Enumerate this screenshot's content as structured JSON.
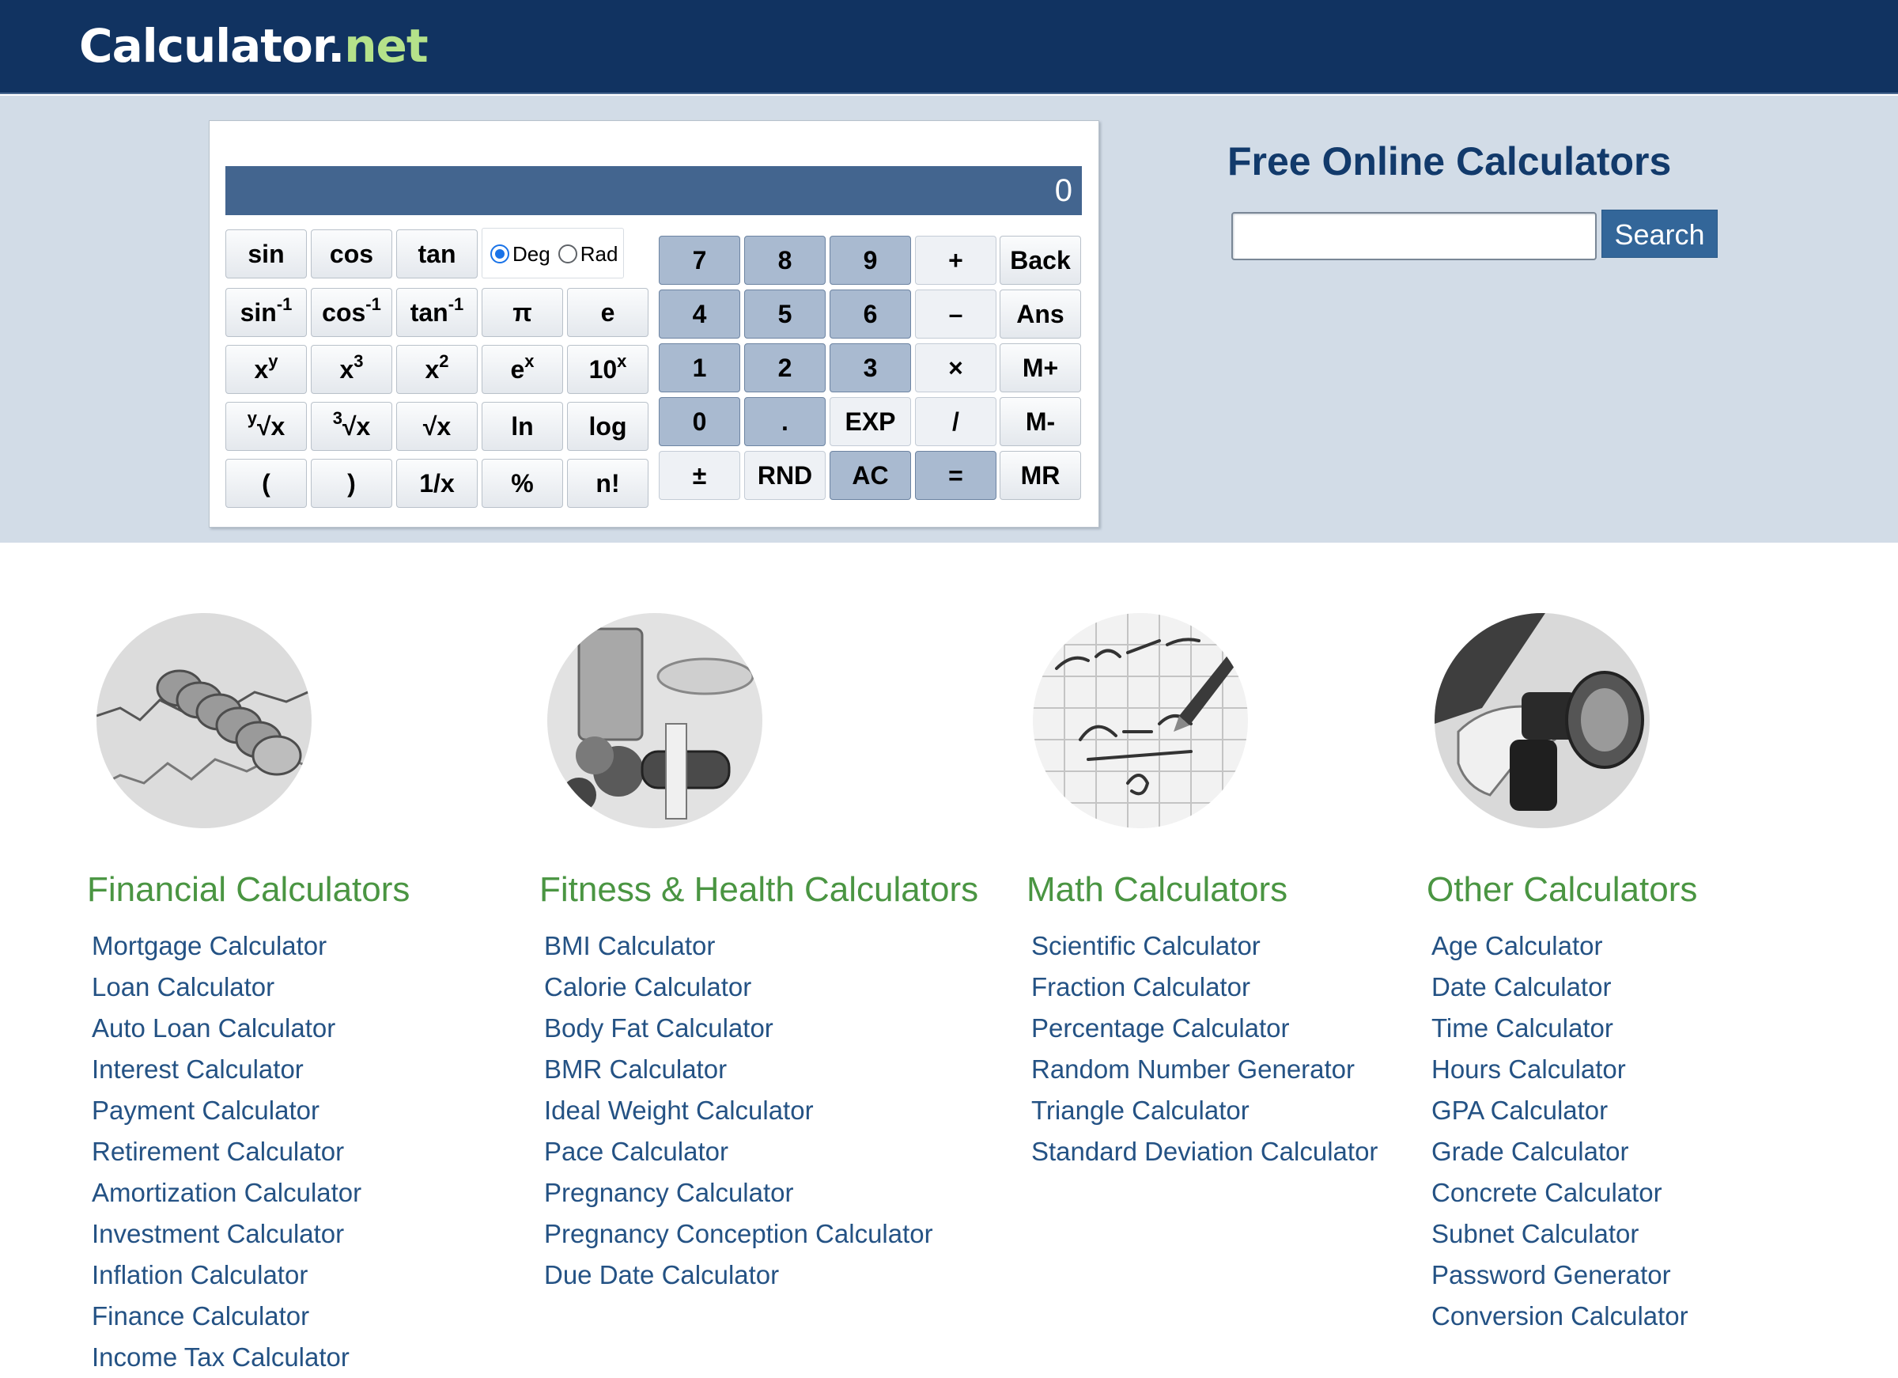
{
  "header": {
    "logo_main": "Calculator",
    "logo_dot": ".",
    "logo_tld": "net"
  },
  "calculator": {
    "display": "0",
    "sci_keys": {
      "sin": "sin",
      "cos": "cos",
      "tan": "tan",
      "asin": "sin",
      "acos": "cos",
      "atan": "tan",
      "inv_sup": "-1",
      "pi": "π",
      "e": "e",
      "x": "x",
      "y_sup": "y",
      "three": "3",
      "two": "2",
      "e_base": "e",
      "ten": "10",
      "y_root": "y",
      "root_x": "√x",
      "cbrt": "3",
      "sqrt": "√x",
      "ln": "ln",
      "log": "log",
      "lparen": "(",
      "rparen": ")",
      "reciprocal": "1/x",
      "percent": "%",
      "factorial": "n!"
    },
    "angle": {
      "deg": "Deg",
      "rad": "Rad",
      "selected": "Deg"
    },
    "num_keys": {
      "k7": "7",
      "k8": "8",
      "k9": "9",
      "plus": "+",
      "back": "Back",
      "k4": "4",
      "k5": "5",
      "k6": "6",
      "minus": "–",
      "ans": "Ans",
      "k1": "1",
      "k2": "2",
      "k3": "3",
      "times": "×",
      "mplus": "M+",
      "k0": "0",
      "dot": ".",
      "exp": "EXP",
      "divide": "/",
      "mminus": "M-",
      "plusminus": "±",
      "rnd": "RND",
      "ac": "AC",
      "equals": "=",
      "mr": "MR"
    }
  },
  "search": {
    "title": "Free Online Calculators",
    "placeholder": "",
    "button": "Search"
  },
  "categories": [
    {
      "title": "Financial Calculators",
      "image_icon": "coins-chart-photo",
      "links": [
        "Mortgage Calculator",
        "Loan Calculator",
        "Auto Loan Calculator",
        "Interest Calculator",
        "Payment Calculator",
        "Retirement Calculator",
        "Amortization Calculator",
        "Investment Calculator",
        "Inflation Calculator",
        "Finance Calculator",
        "Income Tax Calculator"
      ]
    },
    {
      "title": "Fitness & Health Calculators",
      "image_icon": "fitness-food-photo",
      "links": [
        "BMI Calculator",
        "Calorie Calculator",
        "Body Fat Calculator",
        "BMR Calculator",
        "Ideal Weight Calculator",
        "Pace Calculator",
        "Pregnancy Calculator",
        "Pregnancy Conception Calculator",
        "Due Date Calculator"
      ]
    },
    {
      "title": "Math Calculators",
      "image_icon": "math-formula-photo",
      "links": [
        "Scientific Calculator",
        "Fraction Calculator",
        "Percentage Calculator",
        "Random Number Generator",
        "Triangle Calculator",
        "Standard Deviation Calculator"
      ]
    },
    {
      "title": "Other Calculators",
      "image_icon": "fuel-pump-photo",
      "links": [
        "Age Calculator",
        "Date Calculator",
        "Time Calculator",
        "Hours Calculator",
        "GPA Calculator",
        "Grade Calculator",
        "Concrete Calculator",
        "Subnet Calculator",
        "Password Generator",
        "Conversion Calculator"
      ]
    }
  ]
}
